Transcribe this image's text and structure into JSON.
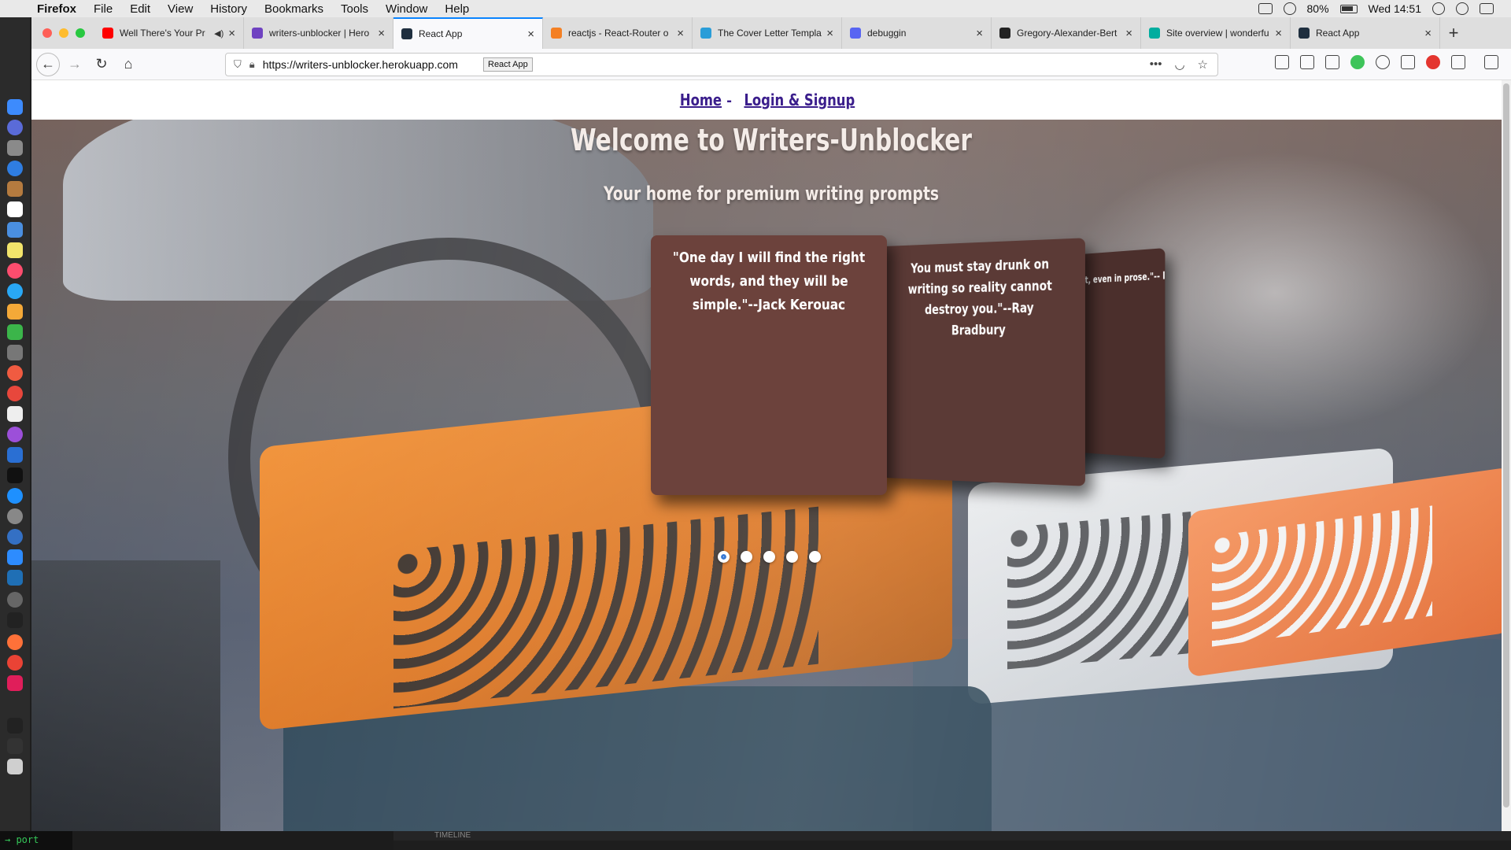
{
  "menubar": {
    "app_name": "Firefox",
    "menus": [
      "File",
      "Edit",
      "View",
      "History",
      "Bookmarks",
      "Tools",
      "Window",
      "Help"
    ],
    "battery": "80%",
    "clock": "Wed 14:51"
  },
  "browser": {
    "tabs": [
      {
        "label": "Well There's Your Pr",
        "favicon_color": "#ff0000",
        "active": false,
        "muted_icon": true
      },
      {
        "label": "writers-unblocker | Hero",
        "favicon_color": "#6f42c1",
        "active": false
      },
      {
        "label": "React App",
        "favicon_color": "#1f2f3f",
        "active": true
      },
      {
        "label": "reactjs - React-Router o",
        "favicon_color": "#f48024",
        "active": false
      },
      {
        "label": "The Cover Letter Templa",
        "favicon_color": "#2a9dd8",
        "active": false
      },
      {
        "label": "debuggin",
        "favicon_color": "#5865f2",
        "active": false
      },
      {
        "label": "Gregory-Alexander-Bert",
        "favicon_color": "#222222",
        "active": false
      },
      {
        "label": "Site overview | wonderfu",
        "favicon_color": "#00ad9f",
        "active": false
      },
      {
        "label": "React App",
        "favicon_color": "#1f2f3f",
        "active": false
      }
    ],
    "url": "https://writers-unblocker.herokuapp.com",
    "tooltip": "React App"
  },
  "page": {
    "nav": {
      "home": "Home",
      "separator": "-",
      "login": "Login & Signup"
    },
    "hero_title": "Welcome to Writers-Unblocker",
    "hero_subtitle": "Your home for premium writing prompts",
    "cards": [
      {
        "quote": "\"One day I will find the right words, and they will be simple.\"--Jack Kerouac"
      },
      {
        "quote": "You must stay drunk on writing so reality cannot destroy you.\"--Ray Bradbury"
      },
      {
        "quote": "poet, even in prose.\"-- les Baudelaire"
      }
    ],
    "carousel": {
      "dot_count": 5,
      "active_index": 0
    }
  },
  "bottom": {
    "terminal_text": "→ port",
    "timeline_label": "TIMELINE"
  }
}
